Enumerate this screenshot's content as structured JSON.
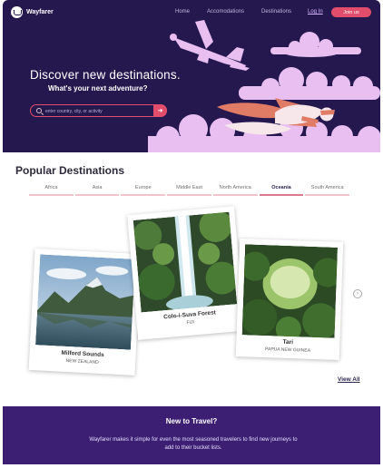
{
  "nav": {
    "brand": "Wayfarer",
    "links": [
      "Home",
      "Accomodations",
      "Destinations"
    ],
    "login": "Log In",
    "join": "Join us"
  },
  "hero": {
    "title": "Discover new destinations.",
    "subtitle": "What's your next adventure?",
    "search_placeholder": "enter country, city, or activity",
    "search_button_icon": "arrow-right-icon"
  },
  "popular": {
    "title": "Popular Destinations",
    "tabs": [
      "Africa",
      "Asia",
      "Europe",
      "Middle East",
      "North America",
      "Oceania",
      "South America"
    ],
    "active_tab": "Oceania",
    "cards": [
      {
        "name": "Milford Sounds",
        "place": "NEW ZEALAND"
      },
      {
        "name": "Colo-i-Suva Forest",
        "place": "FIJI"
      },
      {
        "name": "Tari",
        "place": "PAPUA NEW GUINEA"
      }
    ],
    "next_icon": "chevron-right-icon",
    "view_all": "View All"
  },
  "promo": {
    "title": "New to Travel?",
    "text": "Wayfarer makes it simple for even the most seasoned travelers to find new journeys to add to their bucket lists."
  },
  "colors": {
    "hero_bg": "#25184f",
    "accent": "#e24d6b",
    "band_bg": "#3c1f72",
    "cloud": "#e8bff0"
  }
}
